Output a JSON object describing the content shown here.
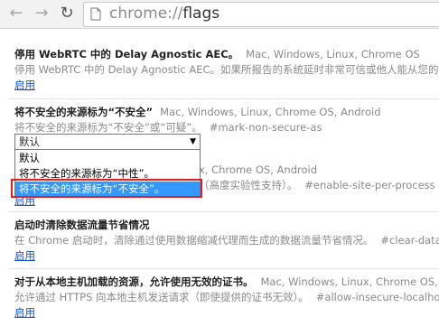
{
  "browser": {
    "url_scheme": "chrome://",
    "url_path": "flags"
  },
  "experiments": [
    {
      "title": "停用 WebRTC 中的 Delay Agnostic AEC。",
      "platforms": "Mac, Windows, Linux, Chrome OS",
      "description": "停用 WebRTC 中的 Delay Agnostic AEC。如果所报告的系统延时非常可信或他人能从您的",
      "link": "启用"
    },
    {
      "title": "将不安全的来源标为“不安全”",
      "platforms": "Mac, Windows, Linux, Chrome OS, Android",
      "description": "将不安全的来源标为“不安全”或“可疑”。",
      "hash": "#mark-non-secure-as",
      "select_value": "默认",
      "options": [
        "默认",
        "将不安全的来源标为“中性”。",
        "将不安全的来源标为“不安全”。"
      ]
    },
    {
      "platforms": "x, Chrome OS, Android",
      "description": "（高度实验性支持）。",
      "hash": "#enable-site-per-process",
      "link": "启用"
    },
    {
      "title": "启动时清除数据流量节省情况",
      "description": "在 Chrome 启动时，清除通过使用数据缩减代理而生成的数据流量节省情况。",
      "hash": "#clear-data",
      "link": "启用"
    },
    {
      "title": "对于从本地主机加载的资源，允许使用无效的证书。",
      "platforms": "Mac, Windows, Linux, Chrome OS, Ar",
      "description": "允许通过 HTTPS 向本地主机发送请求（即使提供的证书无效）。",
      "hash": "#allow-insecure-localho",
      "link": "启用"
    }
  ]
}
